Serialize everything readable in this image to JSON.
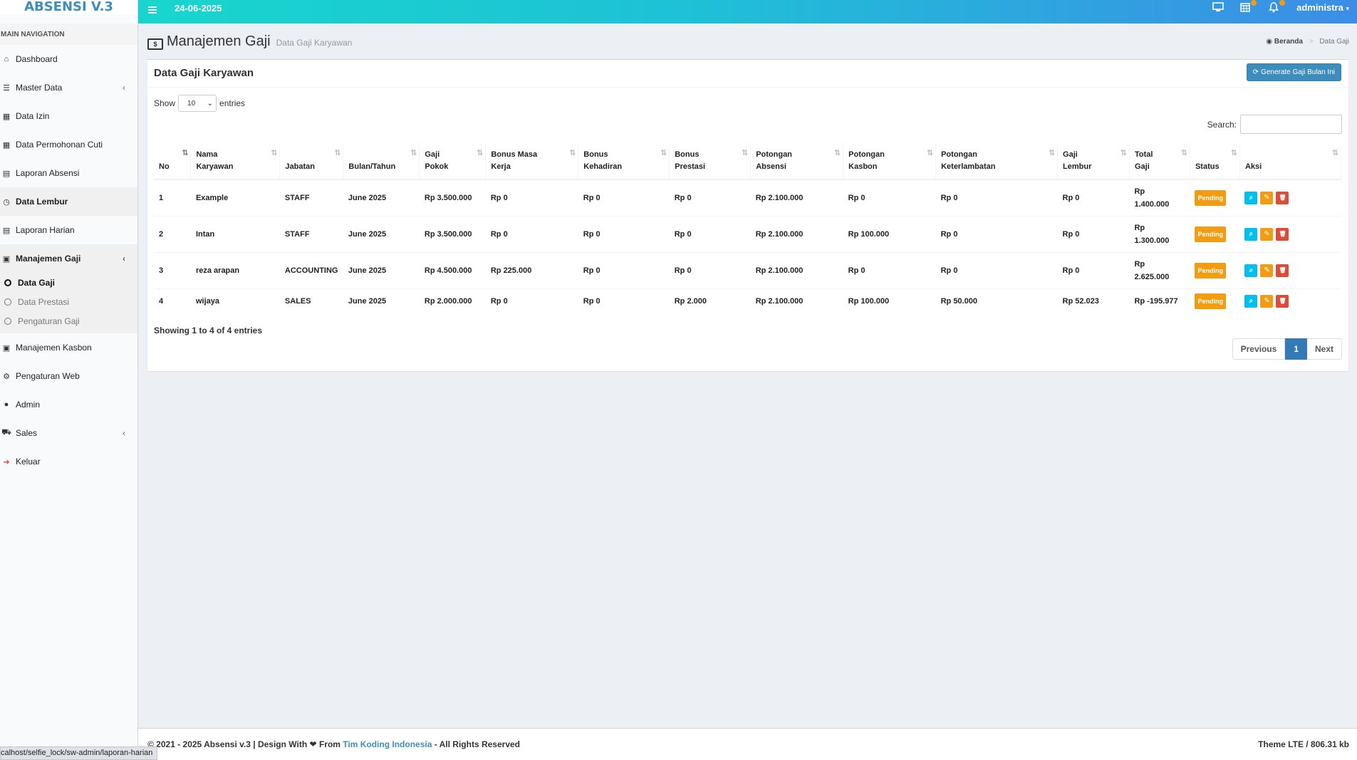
{
  "app": {
    "logo": "ABSENSI V.3"
  },
  "sidebar": {
    "header": "MAIN NAVIGATION",
    "items": [
      {
        "label": "Dashboard",
        "icon": "home-icon"
      },
      {
        "label": "Master Data",
        "icon": "database-icon"
      },
      {
        "label": "Data Izin",
        "icon": "calendar-icon"
      },
      {
        "label": "Data Permohonan Cuti",
        "icon": "calendar-icon"
      },
      {
        "label": "Laporan Absensi",
        "icon": "list-icon"
      },
      {
        "label": "Data Lembur",
        "icon": "clock-icon"
      },
      {
        "label": "Laporan Harian",
        "icon": "list-icon"
      },
      {
        "label": "Manajemen Gaji",
        "icon": "money-icon"
      },
      {
        "label": "Manajemen Kasbon",
        "icon": "money-icon"
      },
      {
        "label": "Pengaturan Web",
        "icon": "gears-icon"
      },
      {
        "label": "Admin",
        "icon": "user-icon"
      },
      {
        "label": "Sales",
        "icon": "cart-icon"
      },
      {
        "label": "Keluar",
        "icon": "sign-out-icon"
      }
    ],
    "submenu": [
      "Data Gaji",
      "Data Prestasi",
      "Pengaturan Gaji"
    ]
  },
  "topbar": {
    "date": "24-06-2025",
    "user": "administra"
  },
  "header": {
    "title": "Manajemen Gaji",
    "subtitle": "Data Gaji Karyawan",
    "breadcrumb_home": "Beranda",
    "breadcrumb_current": "Data Gaji"
  },
  "box": {
    "title": "Data Gaji Karyawan",
    "generate_label": "Generate Gaji Bulan Ini",
    "show_label": "Show",
    "show_value": "10",
    "entries_label": "entries",
    "search_label": "Search:"
  },
  "table": {
    "columns": [
      [
        "No"
      ],
      [
        "Nama",
        "Karyawan"
      ],
      [
        "Jabatan"
      ],
      [
        "Bulan/Tahun"
      ],
      [
        "Gaji",
        "Pokok"
      ],
      [
        "Bonus Masa",
        "Kerja"
      ],
      [
        "Bonus",
        "Kehadiran"
      ],
      [
        "Bonus",
        "Prestasi"
      ],
      [
        "Potongan",
        "Absensi"
      ],
      [
        "Potongan",
        "Kasbon"
      ],
      [
        "Potongan",
        "Keterlambatan"
      ],
      [
        "Gaji",
        "Lembur"
      ],
      [
        "Total",
        "Gaji"
      ],
      [
        "Status"
      ],
      [
        "Aksi"
      ]
    ],
    "rows": [
      {
        "no": "1",
        "nama": "Example",
        "jabatan": "STAFF",
        "bulan": "June 2025",
        "gaji_pokok": "Rp 3.500.000",
        "bonus_masa": "Rp 0",
        "bonus_hadir": "Rp 0",
        "bonus_prestasi": "Rp 0",
        "pot_absensi": "Rp 2.100.000",
        "pot_kasbon": "Rp 0",
        "pot_telat": "Rp 0",
        "gaji_lembur": "Rp 0",
        "total_a": "Rp",
        "total_b": "1.400.000",
        "status": "Pending"
      },
      {
        "no": "2",
        "nama": "Intan",
        "jabatan": "STAFF",
        "bulan": "June 2025",
        "gaji_pokok": "Rp 3.500.000",
        "bonus_masa": "Rp 0",
        "bonus_hadir": "Rp 0",
        "bonus_prestasi": "Rp 0",
        "pot_absensi": "Rp 2.100.000",
        "pot_kasbon": "Rp 100.000",
        "pot_telat": "Rp 0",
        "gaji_lembur": "Rp 0",
        "total_a": "Rp",
        "total_b": "1.300.000",
        "status": "Pending"
      },
      {
        "no": "3",
        "nama": "reza arapan",
        "jabatan": "ACCOUNTING",
        "bulan": "June 2025",
        "gaji_pokok": "Rp 4.500.000",
        "bonus_masa": "Rp 225.000",
        "bonus_hadir": "Rp 0",
        "bonus_prestasi": "Rp 0",
        "pot_absensi": "Rp 2.100.000",
        "pot_kasbon": "Rp 0",
        "pot_telat": "Rp 0",
        "gaji_lembur": "Rp 0",
        "total_a": "Rp",
        "total_b": "2.625.000",
        "status": "Pending"
      },
      {
        "no": "4",
        "nama": "wijaya",
        "jabatan": "SALES",
        "bulan": "June 2025",
        "gaji_pokok": "Rp 2.000.000",
        "bonus_masa": "Rp 0",
        "bonus_hadir": "Rp 0",
        "bonus_prestasi": "Rp 2.000",
        "pot_absensi": "Rp 2.100.000",
        "pot_kasbon": "Rp 100.000",
        "pot_telat": "Rp 50.000",
        "gaji_lembur": "Rp 52.023",
        "total_a": "Rp -195.977",
        "total_b": "",
        "status": "Pending"
      }
    ]
  },
  "pagination": {
    "info": "Showing 1 to 4 of 4 entries",
    "prev": "Previous",
    "current": "1",
    "next": "Next"
  },
  "footer": {
    "left_prefix": "© 2021 - 2025 Absensi v.3 | Design With",
    "left_from": "From",
    "link": "Tim Koding Indonesia",
    "left_suffix": "- All Rights Reserved",
    "right": "Theme LTE / 806.31 kb"
  },
  "statusbar": {
    "url": "calhost/selfie_lock/sw-admin/laporan-harian"
  },
  "colors": {
    "primary": "#3c8dbc",
    "warning": "#f39c12",
    "danger": "#dd4b39",
    "info": "#00c0ef"
  }
}
